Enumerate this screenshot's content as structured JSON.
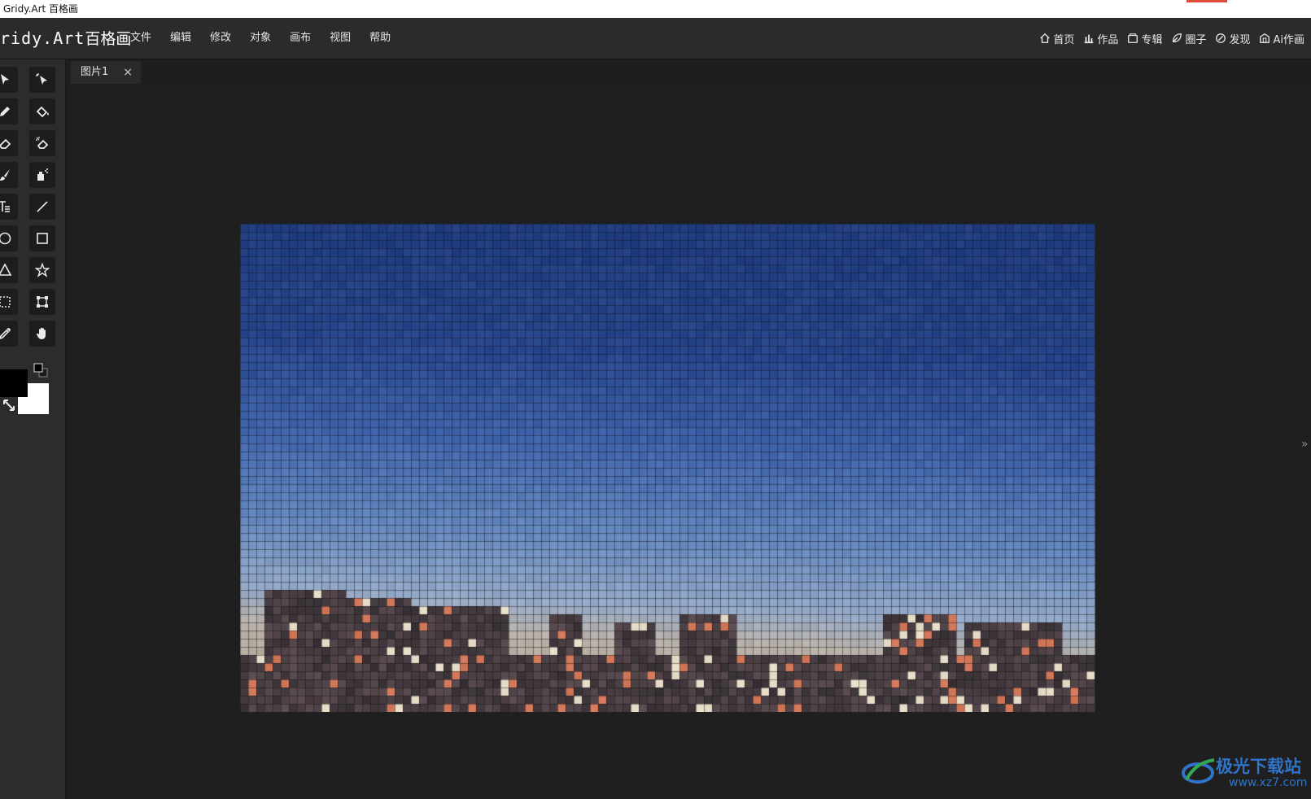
{
  "window": {
    "title": "Gridy.Art 百格画"
  },
  "brand": {
    "logo_text": "ridy.Art",
    "logo_cn": "百格画"
  },
  "menu": [
    {
      "label": "文件"
    },
    {
      "label": "编辑"
    },
    {
      "label": "修改"
    },
    {
      "label": "对象"
    },
    {
      "label": "画布"
    },
    {
      "label": "视图"
    },
    {
      "label": "帮助"
    }
  ],
  "nav": [
    {
      "label": "首页",
      "icon": "home-icon"
    },
    {
      "label": "作品",
      "icon": "chart-icon"
    },
    {
      "label": "专辑",
      "icon": "album-icon"
    },
    {
      "label": "圈子",
      "icon": "leaf-icon"
    },
    {
      "label": "发现",
      "icon": "compass-icon"
    },
    {
      "label": "Ai作画",
      "icon": "ai-icon"
    }
  ],
  "tools": [
    "select-icon",
    "magic-select-icon",
    "pencil-icon",
    "fill-bucket-icon",
    "eraser-icon",
    "magic-eraser-icon",
    "brush-icon",
    "spray-icon",
    "text-icon",
    "line-icon",
    "ellipse-icon",
    "rectangle-icon",
    "triangle-icon",
    "star-icon",
    "marquee-icon",
    "transform-icon",
    "eyedropper-icon",
    "hand-icon"
  ],
  "colors": {
    "foreground": "#000000",
    "background": "#ffffff"
  },
  "tab": {
    "label": "图片1",
    "close": "×"
  },
  "panel_toggle": "»",
  "watermark": {
    "title": "极光下载站",
    "url": "www.xz7.com"
  }
}
